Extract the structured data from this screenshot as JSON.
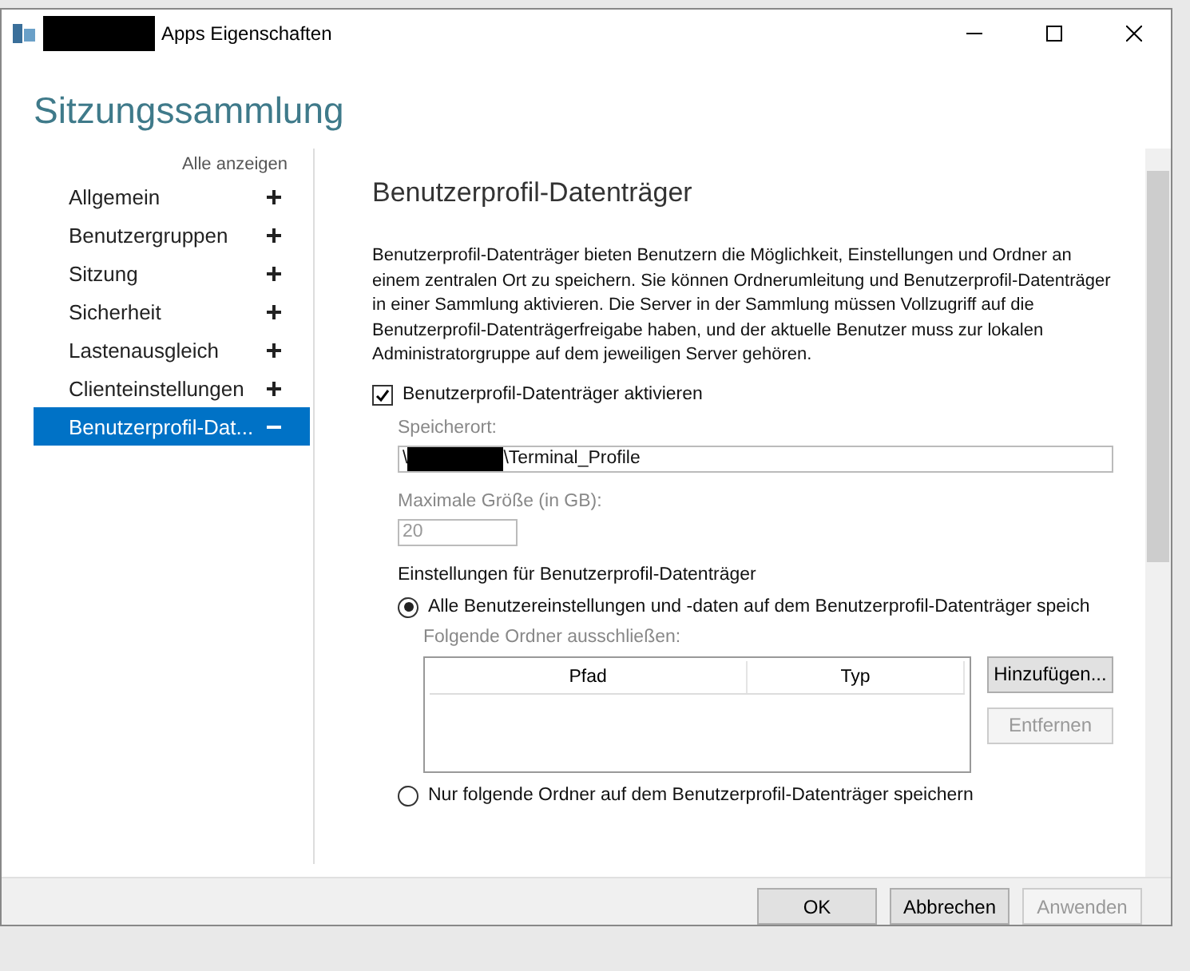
{
  "window": {
    "title": "Apps Eigenschaften",
    "title_redacted": true
  },
  "heading": "Sitzungssammlung",
  "sidebar": {
    "show_all": "Alle anzeigen",
    "items": [
      {
        "label": "Allgemein",
        "selected": false
      },
      {
        "label": "Benutzergruppen",
        "selected": false
      },
      {
        "label": "Sitzung",
        "selected": false
      },
      {
        "label": "Sicherheit",
        "selected": false
      },
      {
        "label": "Lastenausgleich",
        "selected": false
      },
      {
        "label": "Clienteinstellungen",
        "selected": false
      },
      {
        "label": "Benutzerprofil-Dat...",
        "selected": true
      }
    ]
  },
  "section": {
    "title": "Benutzerprofil-Datenträger",
    "description": "Benutzerprofil-Datenträger bieten Benutzern die Möglichkeit, Einstellungen und Ordner an einem zentralen Ort zu speichern. Sie können Ordnerumleitung und Benutzerprofil-Datenträger in einer Sammlung aktivieren. Die Server in der Sammlung müssen Vollzugriff auf die Benutzerprofil-Datenträgerfreigabe haben, und der aktuelle Benutzer muss zur lokalen Administratorgruppe auf dem jeweiligen Server gehören.",
    "enable": {
      "label": "Benutzerprofil-Datenträger aktivieren",
      "checked": true
    },
    "location": {
      "label": "Speicherort:",
      "value_prefix": "\\",
      "value_redacted": true,
      "value_suffix": "\\Terminal_Profile"
    },
    "max_size": {
      "label": "Maximale Größe (in GB):",
      "value": "20",
      "disabled": true
    },
    "settings_label": "Einstellungen für Benutzerprofil-Datenträger",
    "options": [
      {
        "label": "Alle Benutzereinstellungen und -daten auf dem Benutzerprofil-Datenträger speich",
        "selected": true
      },
      {
        "label": "Nur folgende Ordner auf dem Benutzerprofil-Datenträger speichern",
        "selected": false
      }
    ],
    "exclude_label": "Folgende Ordner ausschließen:",
    "exclude_table": {
      "columns": [
        "Pfad",
        "Typ"
      ]
    },
    "side_buttons": [
      {
        "label": "Hinzufügen...",
        "disabled": false
      },
      {
        "label": "Entfernen",
        "disabled": true
      }
    ]
  },
  "footer_buttons": [
    {
      "label": "OK",
      "disabled": false
    },
    {
      "label": "Abbrechen",
      "disabled": false
    },
    {
      "label": "Anwenden",
      "disabled": true
    }
  ]
}
